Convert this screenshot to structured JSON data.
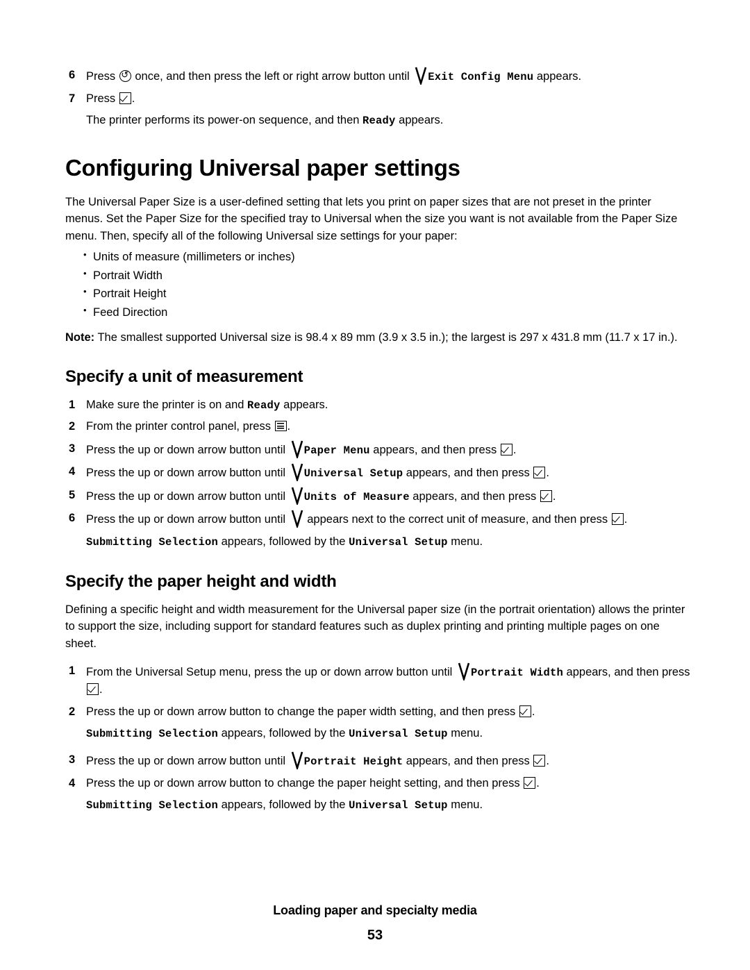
{
  "top_steps": [
    {
      "num": "6",
      "pre": "Press ",
      "icon1": "back-arrow-icon",
      "mid": " once, and then press the left or right arrow button until ",
      "v_icon": "checkmark-stroke-icon",
      "mono": "Exit Config Menu",
      "post": " appears."
    },
    {
      "num": "7",
      "pre": "Press ",
      "icon1": "check-select-icon",
      "mid": ".",
      "post": ""
    }
  ],
  "top_sub": {
    "pre": "The printer performs its power-on sequence, and then ",
    "mono": "Ready",
    "post": " appears."
  },
  "title": "Configuring Universal paper settings",
  "intro_paragraph": "The Universal Paper Size is a user-defined setting that lets you print on paper sizes that are not preset in the printer menus. Set the Paper Size for the specified tray to Universal when the size you want is not available from the Paper Size menu. Then, specify all of the following Universal size settings for your paper:",
  "bullets": [
    "Units of measure (millimeters or inches)",
    "Portrait Width",
    "Portrait Height",
    "Feed Direction"
  ],
  "note": {
    "label": "Note:",
    "text": " The smallest supported Universal size is 98.4 x 89 mm (3.9 x 3.5 in.); the largest is 297 x 431.8 mm (11.7 x 17 in.)."
  },
  "section1": {
    "heading": "Specify a unit of measurement",
    "steps": [
      {
        "num": "1",
        "pre": "Make sure the printer is on and ",
        "mono": "Ready",
        "post": " appears."
      },
      {
        "num": "2",
        "pre": "From the printer control panel, press ",
        "icon": "menu-icon",
        "post": "."
      },
      {
        "num": "3",
        "pre": "Press the up or down arrow button until ",
        "v_icon": "checkmark-stroke-icon",
        "mono": "Paper Menu",
        "mid": " appears, and then press ",
        "icon": "check-select-icon",
        "post": "."
      },
      {
        "num": "4",
        "pre": "Press the up or down arrow button until ",
        "v_icon": "checkmark-stroke-icon",
        "mono": "Universal Setup",
        "mid": " appears, and then press ",
        "icon": "check-select-icon",
        "post": "."
      },
      {
        "num": "5",
        "pre": "Press the up or down arrow button until ",
        "v_icon": "checkmark-stroke-icon",
        "mono": "Units of Measure",
        "mid": " appears, and then press ",
        "icon": "check-select-icon",
        "post": "."
      },
      {
        "num": "6",
        "pre": "Press the up or down arrow button until ",
        "v_icon": "checkmark-stroke-icon",
        "mid": " appears next to the correct unit of measure, and then press ",
        "icon": "check-select-icon",
        "post": "."
      }
    ],
    "result": {
      "mono1": "Submitting Selection",
      "mid": " appears, followed by the ",
      "mono2": "Universal Setup",
      "post": " menu."
    }
  },
  "section2": {
    "heading": "Specify the paper height and width",
    "paragraph": "Defining a specific height and width measurement for the Universal paper size (in the portrait orientation) allows the printer to support the size, including support for standard features such as duplex printing and printing multiple pages on one sheet.",
    "steps": [
      {
        "num": "1",
        "pre": "From the Universal Setup menu, press the up or down arrow button until ",
        "v_icon": "checkmark-stroke-icon",
        "mono": "Portrait Width",
        "mid": " appears, and then press ",
        "icon": "check-select-icon",
        "post": "."
      },
      {
        "num": "2",
        "pre": "Press the up or down arrow button to change the paper width setting, and then press ",
        "icon": "check-select-icon",
        "post": ".",
        "result": {
          "mono1": "Submitting Selection",
          "mid": " appears, followed by the ",
          "mono2": "Universal Setup",
          "post": " menu."
        }
      },
      {
        "num": "3",
        "pre": "Press the up or down arrow button until ",
        "v_icon": "checkmark-stroke-icon",
        "mono": "Portrait Height",
        "mid": " appears, and then press ",
        "icon": "check-select-icon",
        "post": "."
      },
      {
        "num": "4",
        "pre": "Press the up or down arrow button to change the paper height setting, and then press ",
        "icon": "check-select-icon",
        "post": ".",
        "result": {
          "mono1": "Submitting Selection",
          "mid": " appears, followed by the ",
          "mono2": "Universal Setup",
          "post": " menu."
        }
      }
    ]
  },
  "footer": {
    "chapter": "Loading paper and specialty media",
    "page_number": "53"
  }
}
